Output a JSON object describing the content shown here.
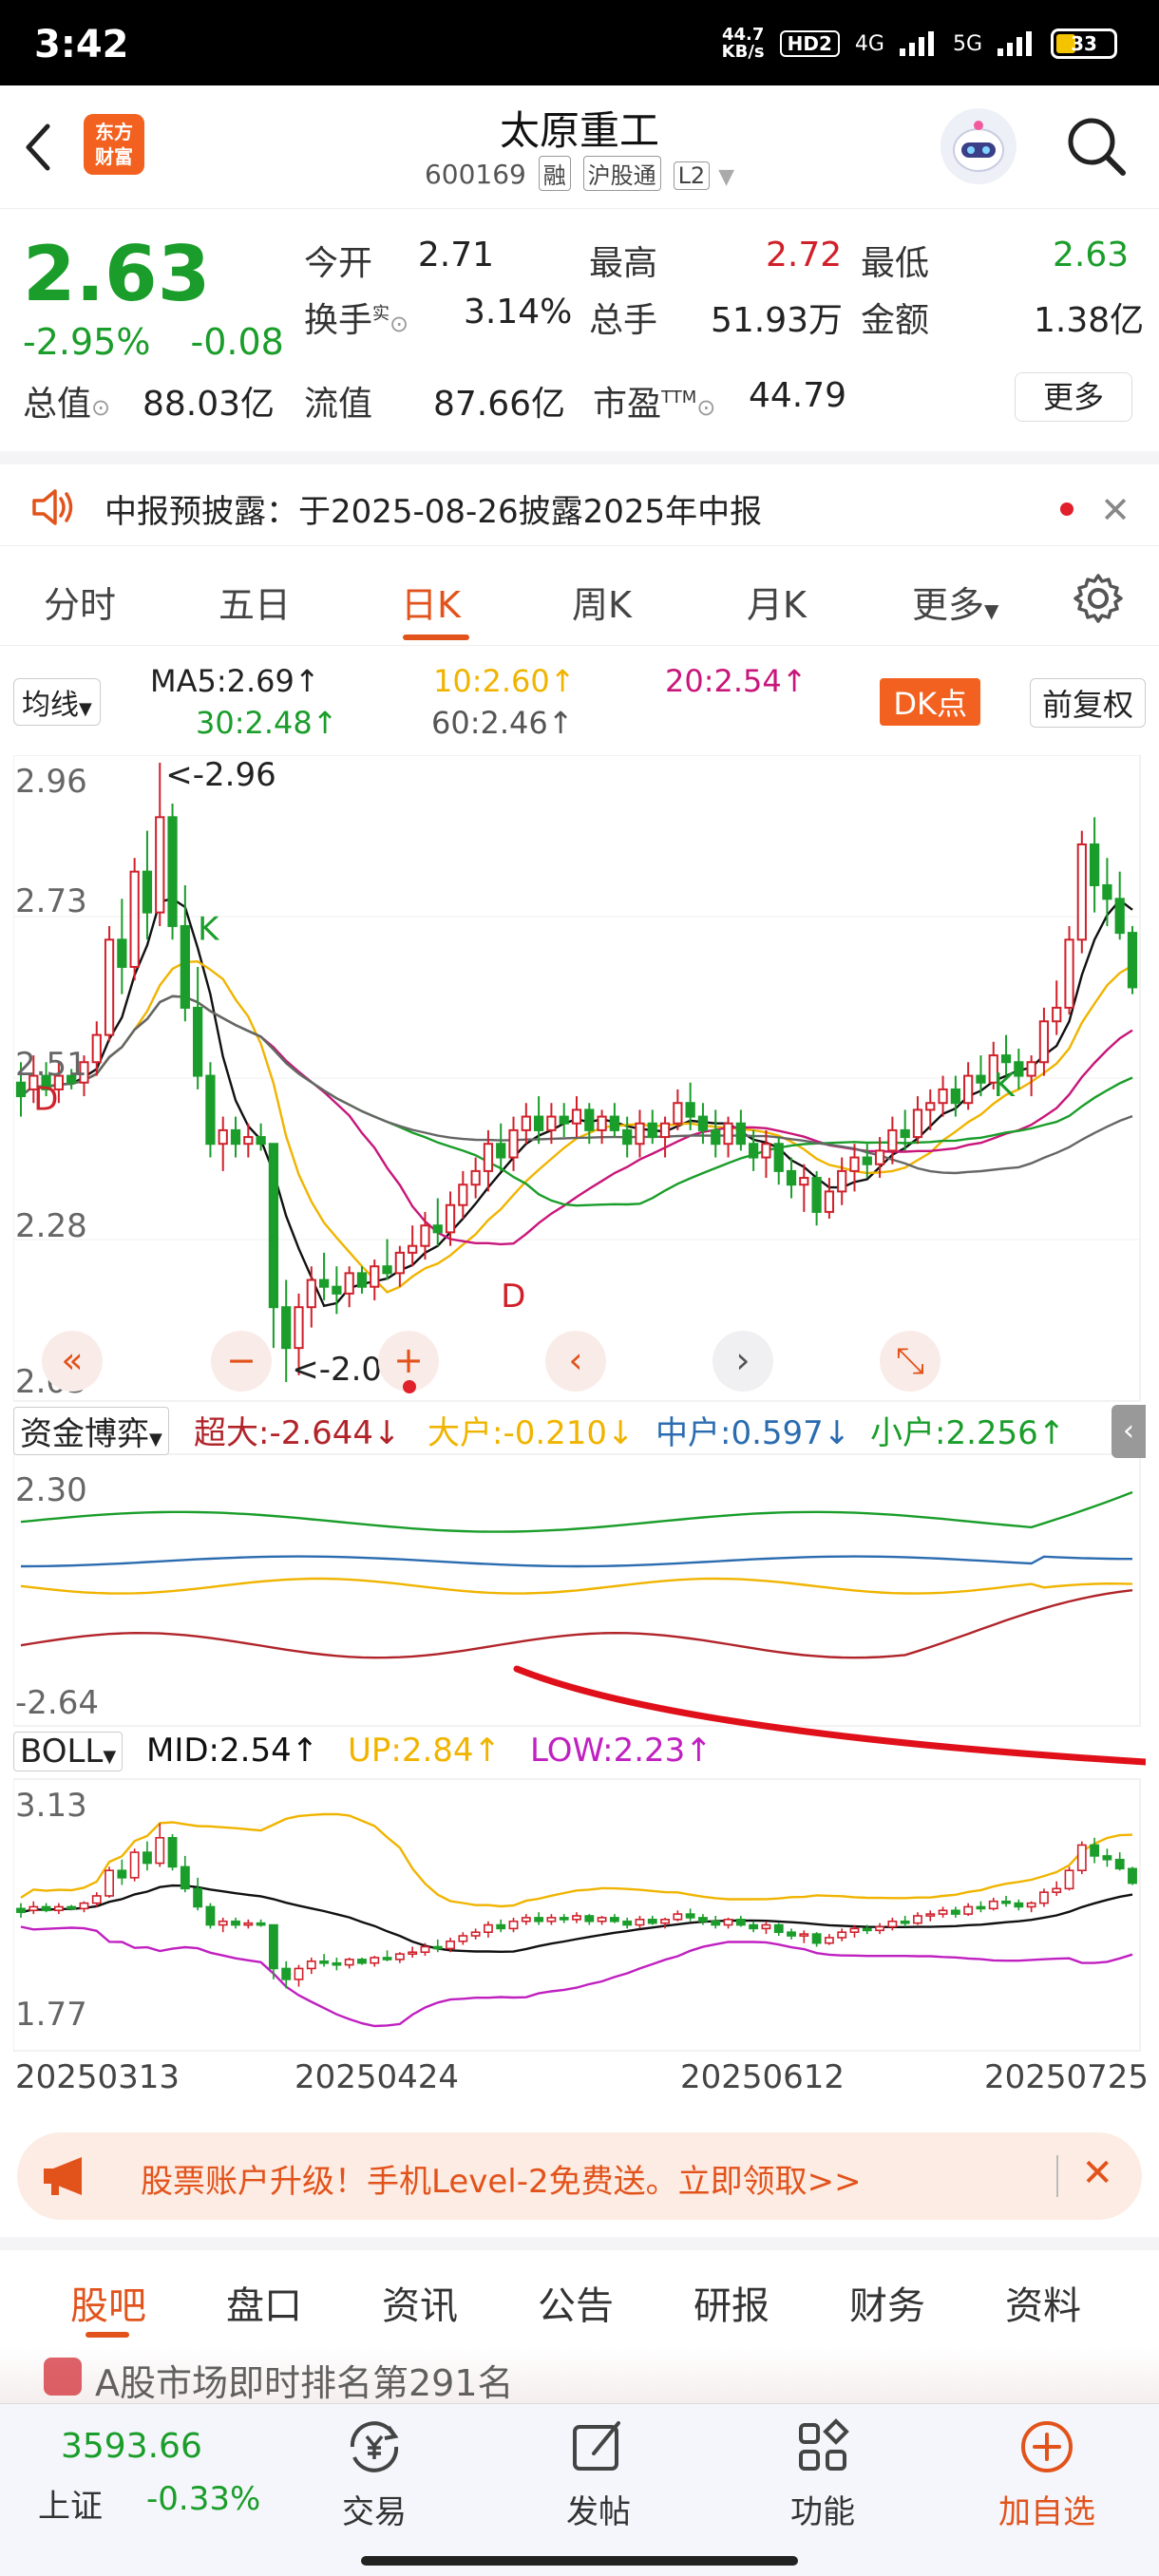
{
  "status": {
    "time": "3:42",
    "speed_top": "44.7",
    "speed_bottom": "KB/s",
    "hd": "HD2",
    "net1": "4G",
    "net2": "5G",
    "battery": "33"
  },
  "header": {
    "title": "太原重工",
    "code": "600169",
    "tags": [
      "融",
      "沪股通",
      "L2"
    ],
    "logo_text": [
      "东方",
      "财富"
    ]
  },
  "quote": {
    "price": "2.63",
    "change_pct": "-2.95%",
    "change": "-0.08",
    "rows": [
      [
        {
          "l": "今开",
          "v": "2.71",
          "c": "#222"
        },
        {
          "l": "最高",
          "v": "2.72",
          "c": "#d0202a"
        },
        {
          "l": "最低",
          "v": "2.63",
          "c": "#1a9d2a"
        }
      ],
      [
        {
          "l": "换手",
          "v": "3.14%",
          "c": "#222",
          "sup": "实"
        },
        {
          "l": "总手",
          "v": "51.93万",
          "c": "#222"
        },
        {
          "l": "金额",
          "v": "1.38亿",
          "c": "#222"
        }
      ]
    ],
    "total_label": "总值",
    "total_value": "88.03亿",
    "float_label": "流值",
    "float_value": "87.66亿",
    "pe_label": "市盈",
    "pe_sup": "TTM",
    "pe_value": "44.79",
    "more": "更多"
  },
  "notice": {
    "text": "中报预披露：于2025-08-26披露2025年中报"
  },
  "tabs": [
    "分时",
    "五日",
    "日K",
    "周K",
    "月K",
    "更多"
  ],
  "active_tab": 2,
  "ma": {
    "select": "均线",
    "items": [
      {
        "t": "MA5:2.69↑",
        "c": "#222"
      },
      {
        "t": "10:2.60↑",
        "c": "#f0b400"
      },
      {
        "t": "20:2.54↑",
        "c": "#c8167a"
      },
      {
        "t": "30:2.48↑",
        "c": "#1a9d2a"
      },
      {
        "t": "60:2.46↑",
        "c": "#555555"
      }
    ],
    "dk": "DK点",
    "fq": "前复权"
  },
  "chart_data": [
    {
      "type": "candlestick",
      "title": "日K",
      "y_labels": [
        "2.96",
        "2.73",
        "2.51",
        "2.28",
        "2.05"
      ],
      "ylim": [
        2.05,
        2.96
      ],
      "annotations": [
        {
          "text": "<-2.96",
          "value": 2.96
        },
        {
          "text": "<-2.05",
          "value": 2.05
        },
        {
          "text": "K",
          "color": "#1a9d2a"
        },
        {
          "text": "D",
          "color": "#d0202a"
        },
        {
          "text": "D",
          "color": "#d0202a"
        },
        {
          "text": "K",
          "color": "#1a9d2a"
        },
        {
          "text": "D",
          "color": "#d0202a"
        }
      ],
      "candles": [
        [
          2.49,
          2.52,
          2.44,
          2.47
        ],
        [
          2.48,
          2.53,
          2.46,
          2.5
        ],
        [
          2.5,
          2.52,
          2.47,
          2.48
        ],
        [
          2.48,
          2.52,
          2.46,
          2.5
        ],
        [
          2.5,
          2.51,
          2.48,
          2.49
        ],
        [
          2.49,
          2.53,
          2.47,
          2.52
        ],
        [
          2.52,
          2.58,
          2.5,
          2.56
        ],
        [
          2.56,
          2.72,
          2.55,
          2.7
        ],
        [
          2.7,
          2.76,
          2.62,
          2.66
        ],
        [
          2.66,
          2.82,
          2.64,
          2.8
        ],
        [
          2.8,
          2.86,
          2.7,
          2.74
        ],
        [
          2.74,
          2.96,
          2.72,
          2.88
        ],
        [
          2.88,
          2.9,
          2.7,
          2.72
        ],
        [
          2.72,
          2.78,
          2.58,
          2.6
        ],
        [
          2.6,
          2.66,
          2.48,
          2.5
        ],
        [
          2.5,
          2.52,
          2.38,
          2.4
        ],
        [
          2.4,
          2.44,
          2.36,
          2.42
        ],
        [
          2.42,
          2.44,
          2.38,
          2.4
        ],
        [
          2.4,
          2.43,
          2.38,
          2.41
        ],
        [
          2.41,
          2.43,
          2.39,
          2.4
        ],
        [
          2.4,
          2.4,
          2.1,
          2.16
        ],
        [
          2.16,
          2.2,
          2.05,
          2.1
        ],
        [
          2.1,
          2.18,
          2.06,
          2.16
        ],
        [
          2.16,
          2.22,
          2.13,
          2.2
        ],
        [
          2.2,
          2.24,
          2.17,
          2.19
        ],
        [
          2.19,
          2.22,
          2.15,
          2.18
        ],
        [
          2.18,
          2.22,
          2.16,
          2.21
        ],
        [
          2.21,
          2.22,
          2.18,
          2.19
        ],
        [
          2.19,
          2.23,
          2.17,
          2.22
        ],
        [
          2.22,
          2.26,
          2.2,
          2.21
        ],
        [
          2.21,
          2.25,
          2.19,
          2.24
        ],
        [
          2.24,
          2.28,
          2.22,
          2.25
        ],
        [
          2.25,
          2.3,
          2.23,
          2.28
        ],
        [
          2.28,
          2.32,
          2.25,
          2.27
        ],
        [
          2.27,
          2.33,
          2.25,
          2.31
        ],
        [
          2.31,
          2.36,
          2.29,
          2.34
        ],
        [
          2.34,
          2.38,
          2.32,
          2.36
        ],
        [
          2.36,
          2.42,
          2.33,
          2.4
        ],
        [
          2.4,
          2.43,
          2.36,
          2.38
        ],
        [
          2.38,
          2.44,
          2.36,
          2.42
        ],
        [
          2.42,
          2.46,
          2.4,
          2.44
        ],
        [
          2.44,
          2.47,
          2.4,
          2.42
        ],
        [
          2.42,
          2.46,
          2.4,
          2.44
        ],
        [
          2.44,
          2.46,
          2.41,
          2.43
        ],
        [
          2.43,
          2.47,
          2.41,
          2.45
        ],
        [
          2.45,
          2.46,
          2.4,
          2.42
        ],
        [
          2.42,
          2.45,
          2.4,
          2.44
        ],
        [
          2.44,
          2.46,
          2.41,
          2.42
        ],
        [
          2.42,
          2.44,
          2.38,
          2.4
        ],
        [
          2.4,
          2.45,
          2.38,
          2.43
        ],
        [
          2.43,
          2.45,
          2.4,
          2.41
        ],
        [
          2.41,
          2.44,
          2.38,
          2.43
        ],
        [
          2.43,
          2.48,
          2.42,
          2.46
        ],
        [
          2.46,
          2.49,
          2.42,
          2.44
        ],
        [
          2.44,
          2.46,
          2.4,
          2.42
        ],
        [
          2.42,
          2.45,
          2.38,
          2.4
        ],
        [
          2.4,
          2.44,
          2.38,
          2.43
        ],
        [
          2.43,
          2.45,
          2.39,
          2.4
        ],
        [
          2.4,
          2.42,
          2.36,
          2.38
        ],
        [
          2.38,
          2.42,
          2.35,
          2.4
        ],
        [
          2.4,
          2.41,
          2.34,
          2.36
        ],
        [
          2.36,
          2.38,
          2.32,
          2.34
        ],
        [
          2.34,
          2.37,
          2.3,
          2.35
        ],
        [
          2.35,
          2.36,
          2.28,
          2.3
        ],
        [
          2.3,
          2.35,
          2.29,
          2.33
        ],
        [
          2.33,
          2.38,
          2.31,
          2.36
        ],
        [
          2.36,
          2.4,
          2.33,
          2.38
        ],
        [
          2.38,
          2.4,
          2.35,
          2.37
        ],
        [
          2.37,
          2.41,
          2.35,
          2.39
        ],
        [
          2.39,
          2.44,
          2.37,
          2.42
        ],
        [
          2.42,
          2.45,
          2.39,
          2.41
        ],
        [
          2.41,
          2.47,
          2.4,
          2.45
        ],
        [
          2.45,
          2.48,
          2.42,
          2.46
        ],
        [
          2.46,
          2.5,
          2.44,
          2.48
        ],
        [
          2.48,
          2.5,
          2.44,
          2.46
        ],
        [
          2.46,
          2.52,
          2.45,
          2.5
        ],
        [
          2.5,
          2.53,
          2.47,
          2.49
        ],
        [
          2.49,
          2.55,
          2.48,
          2.53
        ],
        [
          2.53,
          2.56,
          2.5,
          2.52
        ],
        [
          2.52,
          2.54,
          2.48,
          2.5
        ],
        [
          2.5,
          2.53,
          2.47,
          2.52
        ],
        [
          2.52,
          2.6,
          2.5,
          2.58
        ],
        [
          2.58,
          2.64,
          2.56,
          2.6
        ],
        [
          2.6,
          2.72,
          2.59,
          2.7
        ],
        [
          2.7,
          2.86,
          2.68,
          2.84
        ],
        [
          2.84,
          2.88,
          2.74,
          2.78
        ],
        [
          2.78,
          2.82,
          2.72,
          2.76
        ],
        [
          2.76,
          2.8,
          2.7,
          2.71
        ],
        [
          2.71,
          2.72,
          2.62,
          2.63
        ]
      ]
    },
    {
      "type": "line",
      "title": "资金博弈",
      "y_labels": [
        "2.30",
        "-2.64"
      ],
      "series": [
        {
          "name": "超大:-2.644↓",
          "color": "#b0242a"
        },
        {
          "name": "大户:-0.210↓",
          "color": "#f0b400"
        },
        {
          "name": "中户:0.597↓",
          "color": "#2b6cb0"
        },
        {
          "name": "小户:2.256↑",
          "color": "#1a9d2a"
        }
      ]
    },
    {
      "type": "candlestick",
      "title": "BOLL",
      "y_labels": [
        "3.13",
        "1.77"
      ],
      "series": [
        {
          "name": "MID:2.54↑",
          "color": "#111111"
        },
        {
          "name": "UP:2.84↑",
          "color": "#f0b400"
        },
        {
          "name": "LOW:2.23↑",
          "color": "#c020c0"
        }
      ]
    }
  ],
  "dates": [
    "20250313",
    "20250424",
    "20250612",
    "20250725"
  ],
  "ad": {
    "text": "股票账户升级！手机Level-2免费送。立即领取>>"
  },
  "bottom_tabs": [
    "股吧",
    "盘口",
    "资讯",
    "公告",
    "研报",
    "财务",
    "资料"
  ],
  "bottom_active": 0,
  "peek": {
    "text": "A股市场即时排名第291名"
  },
  "nav": {
    "index_value": "3593.66",
    "index_name": "上证",
    "index_change": "-0.33%",
    "items": [
      "交易",
      "发帖",
      "功能",
      "加自选"
    ]
  }
}
